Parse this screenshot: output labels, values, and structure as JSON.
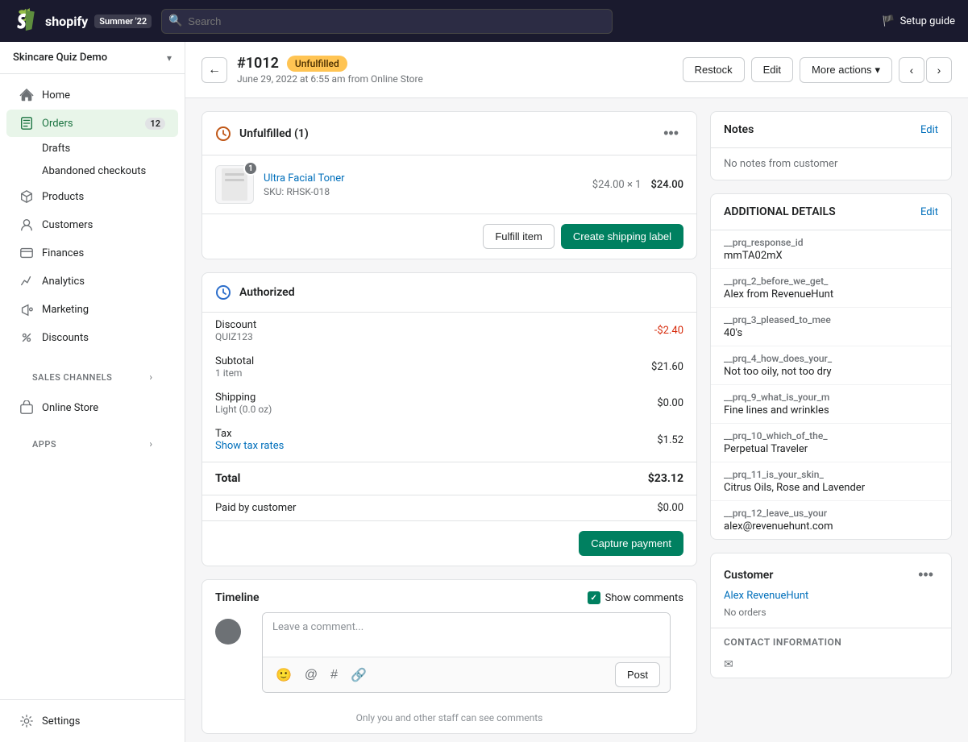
{
  "topbar": {
    "logo_text": "shopify",
    "store_badge": "Summer '22",
    "search_placeholder": "Search",
    "setup_guide_label": "Setup guide"
  },
  "sidebar": {
    "store_name": "Skincare Quiz Demo",
    "nav_items": [
      {
        "id": "home",
        "label": "Home",
        "icon": "🏠",
        "active": false
      },
      {
        "id": "orders",
        "label": "Orders",
        "icon": "📋",
        "active": true,
        "badge": "12"
      },
      {
        "id": "drafts",
        "label": "Drafts",
        "icon": "",
        "active": false,
        "sub": true
      },
      {
        "id": "abandoned",
        "label": "Abandoned checkouts",
        "icon": "",
        "active": false,
        "sub": true
      },
      {
        "id": "products",
        "label": "Products",
        "icon": "🏷️",
        "active": false
      },
      {
        "id": "customers",
        "label": "Customers",
        "icon": "👤",
        "active": false
      },
      {
        "id": "finances",
        "label": "Finances",
        "icon": "🏦",
        "active": false
      },
      {
        "id": "analytics",
        "label": "Analytics",
        "icon": "📊",
        "active": false
      },
      {
        "id": "marketing",
        "label": "Marketing",
        "icon": "📢",
        "active": false
      },
      {
        "id": "discounts",
        "label": "Discounts",
        "icon": "🏷",
        "active": false
      }
    ],
    "sales_channels_label": "Sales channels",
    "online_store_label": "Online Store",
    "apps_label": "Apps",
    "settings_label": "Settings"
  },
  "order": {
    "number": "#1012",
    "status": "Unfulfilled",
    "date": "June 29, 2022 at 6:55 am from Online Store",
    "back_btn": "←",
    "restock_btn": "Restock",
    "edit_btn": "Edit",
    "more_actions_btn": "More actions"
  },
  "unfulfilled_card": {
    "title": "Unfulfilled (1)",
    "product": {
      "name": "Ultra Facial Toner",
      "sku": "SKU: RHSK-018",
      "qty": 1,
      "unit_price": "$24.00",
      "price_x_qty": "$24.00 × 1",
      "total": "$24.00"
    },
    "fulfill_item_btn": "Fulfill item",
    "create_shipping_label_btn": "Create shipping label"
  },
  "authorized_card": {
    "title": "Authorized",
    "rows": [
      {
        "label": "Discount",
        "sublabel": "QUIZ123",
        "value": "-$2.40",
        "negative": true
      },
      {
        "label": "Subtotal",
        "sublabel": "1 item",
        "value": "$21.60",
        "negative": false
      },
      {
        "label": "Shipping",
        "sublabel": "Light (0.0 oz)",
        "value": "$0.00",
        "negative": false
      },
      {
        "label": "Tax",
        "sublabel": "Show tax rates",
        "value": "$1.52",
        "negative": false,
        "sublabel_link": true
      }
    ],
    "total_label": "Total",
    "total_value": "$23.12",
    "paid_label": "Paid by customer",
    "paid_value": "$0.00",
    "capture_payment_btn": "Capture payment"
  },
  "timeline": {
    "title": "Timeline",
    "show_comments_label": "Show comments",
    "comment_placeholder": "Leave a comment...",
    "post_btn": "Post",
    "hint": "Only you and other staff can see comments"
  },
  "notes_card": {
    "title": "Notes",
    "edit_label": "Edit",
    "empty_message": "No notes from customer"
  },
  "additional_details": {
    "title": "ADDITIONAL DETAILS",
    "edit_label": "Edit",
    "fields": [
      {
        "key": "__prq_response_id",
        "value": "mmTA02mX"
      },
      {
        "key": "__prq_2_before_we_get_",
        "value": "Alex from RevenueHunt"
      },
      {
        "key": "__prq_3_pleased_to_mee",
        "value": "40's"
      },
      {
        "key": "__prq_4_how_does_your_",
        "value": "Not too oily, not too dry"
      },
      {
        "key": "__prq_9_what_is_your_m",
        "value": "Fine lines and wrinkles"
      },
      {
        "key": "__prq_10_which_of_the_",
        "value": "Perpetual Traveler"
      },
      {
        "key": "__prq_11_is_your_skin_",
        "value": "Citrus Oils, Rose and Lavender"
      },
      {
        "key": "__prq_12_leave_us_your",
        "value": "alex@revenuehunt.com"
      }
    ]
  },
  "customer_card": {
    "title": "Customer",
    "customer_name": "Alex RevenueHunt",
    "orders_text": "No orders",
    "contact_info_title": "CONTACT INFORMATION"
  }
}
